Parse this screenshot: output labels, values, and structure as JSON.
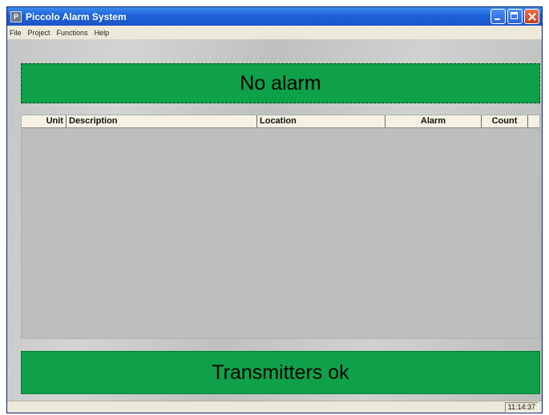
{
  "window": {
    "title": "Piccolo Alarm System"
  },
  "menu": {
    "items": [
      "File",
      "Project",
      "Functions",
      "Help"
    ]
  },
  "alarm_banner": {
    "text": "No alarm",
    "color": "#0fa14a"
  },
  "table": {
    "columns": {
      "unit": "Unit",
      "description": "Description",
      "location": "Location",
      "alarm": "Alarm",
      "count": "Count"
    },
    "rows": []
  },
  "transmitter_banner": {
    "text": "Transmitters ok",
    "color": "#0fa14a"
  },
  "statusbar": {
    "time": "11:14:37"
  }
}
